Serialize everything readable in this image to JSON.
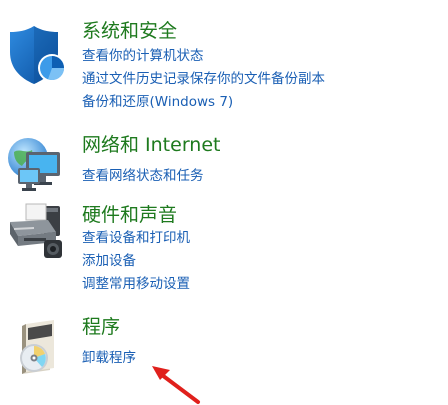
{
  "categories": [
    {
      "id": "system",
      "title": "系统和安全",
      "icon": "shield-icon",
      "links": [
        "查看你的计算机状态",
        "通过文件历史记录保存你的文件备份副本",
        "备份和还原(Windows 7)"
      ]
    },
    {
      "id": "network",
      "title": "网络和 Internet",
      "icon": "network-globe-icon",
      "links": [
        "查看网络状态和任务"
      ]
    },
    {
      "id": "hardware",
      "title": "硬件和声音",
      "icon": "printer-icon",
      "links": [
        "查看设备和打印机",
        "添加设备",
        "调整常用移动设置"
      ]
    },
    {
      "id": "programs",
      "title": "程序",
      "icon": "programs-disc-icon",
      "links": [
        "卸载程序"
      ]
    }
  ],
  "annotation": {
    "icon": "red-arrow-icon",
    "color": "#e0201c"
  },
  "colors": {
    "title": "#1e7a1e",
    "link": "#1a5fb4"
  }
}
